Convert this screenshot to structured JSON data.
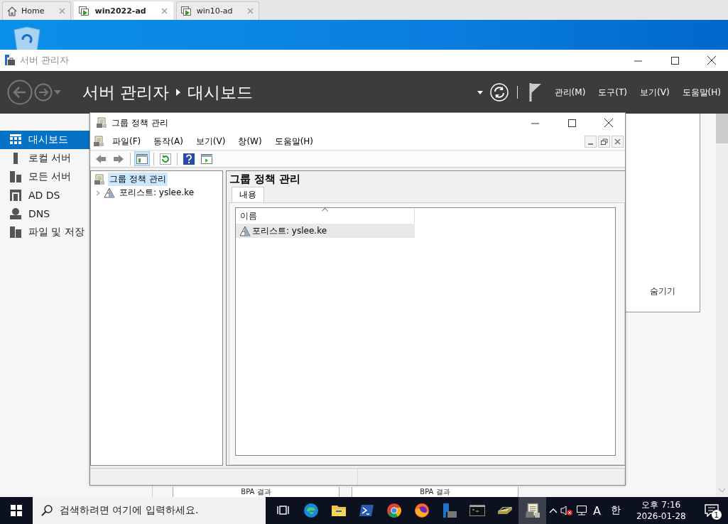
{
  "browser_tabs": [
    {
      "label": "Home",
      "kind": "home",
      "selected": false
    },
    {
      "label": "win2022-ad",
      "kind": "vm",
      "selected": true
    },
    {
      "label": "win10-ad",
      "kind": "vm",
      "selected": false
    }
  ],
  "server_manager": {
    "title": "서버 관리자",
    "breadcrumb": [
      "서버 관리자",
      "대시보드"
    ],
    "menu": [
      "관리(M)",
      "도구(T)",
      "보기(V)",
      "도움말(H)"
    ],
    "sidebar": [
      {
        "label": "대시보드",
        "kind": "dashboard",
        "selected": true
      },
      {
        "label": "로컬 서버",
        "kind": "local",
        "selected": false
      },
      {
        "label": "모든 서버",
        "kind": "all",
        "selected": false
      },
      {
        "label": "AD DS",
        "kind": "adds",
        "selected": false
      },
      {
        "label": "DNS",
        "kind": "dns",
        "selected": false
      },
      {
        "label": "파일 및 저장",
        "kind": "files",
        "selected": false
      }
    ],
    "hide_link": "숨기기",
    "cards": [
      "BPA 결과",
      "BPA 결과"
    ]
  },
  "gpm": {
    "title": "그룹 정책 관리",
    "menu": [
      "파일(F)",
      "동작(A)",
      "보기(V)",
      "창(W)",
      "도움말(H)"
    ],
    "toolbar": [
      {
        "kind": "back",
        "pressed": false
      },
      {
        "kind": "forward",
        "pressed": false
      },
      {
        "kind": "tree",
        "pressed": true
      },
      {
        "kind": "refresh",
        "pressed": false
      },
      {
        "kind": "help",
        "pressed": false
      },
      {
        "kind": "action",
        "pressed": false
      }
    ],
    "tree": [
      {
        "label": "그룹 정책 관리",
        "selected": true,
        "children": [
          {
            "label": "포리스트: yslee.ke",
            "selected": false,
            "expanded": false
          }
        ]
      }
    ],
    "pane_title": "그룹 정책 관리",
    "pane_tabs": [
      {
        "label": "내용",
        "selected": true
      }
    ],
    "list": {
      "columns": [
        "이름"
      ],
      "rows": [
        {
          "name": "포리스트: yslee.ke",
          "selected": true
        }
      ]
    }
  },
  "taskbar": {
    "search_placeholder": "검색하려면 여기에 입력하세요.",
    "apps": [
      {
        "kind": "edge",
        "active": false
      },
      {
        "kind": "explorer",
        "active": false
      },
      {
        "kind": "powershell",
        "active": false
      },
      {
        "kind": "chrome",
        "active": false
      },
      {
        "kind": "firefox",
        "active": false
      },
      {
        "kind": "server",
        "active": false
      },
      {
        "kind": "cmd",
        "active": false
      },
      {
        "kind": "drive",
        "active": false
      },
      {
        "kind": "gpm",
        "active": true
      }
    ],
    "ime_mode": "A",
    "ime_lang": "한",
    "time": "오후 7:16",
    "date": "2026-01-28",
    "notifications": "1"
  }
}
